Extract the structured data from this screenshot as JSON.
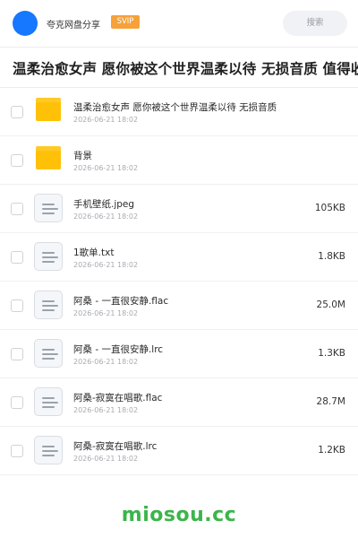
{
  "header": {
    "user_name": "夸克网盘分享",
    "badge": "SVIP",
    "search_placeholder": "搜索",
    "accent_color": "#1677ff"
  },
  "share": {
    "title": "温柔治愈女声 愿你被这个世界温柔以待 无损音质 值得收藏"
  },
  "files": [
    {
      "name": "温柔治愈女声  愿你被这个世界温柔以待 无损音质",
      "date": "2026-06-21 18:02",
      "size": "",
      "type": "folder",
      "icon": "folder-icon"
    },
    {
      "name": "背景",
      "date": "2026-06-21 18:02",
      "size": "",
      "type": "folder",
      "icon": "folder-icon"
    },
    {
      "name": "手机壁纸.jpeg",
      "date": "2026-06-21 18:02",
      "size": "105KB",
      "type": "file",
      "icon": "file-icon"
    },
    {
      "name": "1歌单.txt",
      "date": "2026-06-21 18:02",
      "size": "1.8KB",
      "type": "file",
      "icon": "file-icon"
    },
    {
      "name": "阿桑 - 一直很安静.flac",
      "date": "2026-06-21 18:02",
      "size": "25.0M",
      "type": "file",
      "icon": "file-icon"
    },
    {
      "name": "阿桑 - 一直很安静.lrc",
      "date": "2026-06-21 18:02",
      "size": "1.3KB",
      "type": "file",
      "icon": "file-icon"
    },
    {
      "name": "阿桑-寂寞在唱歌.flac",
      "date": "2026-06-21 18:02",
      "size": "28.7M",
      "type": "file",
      "icon": "file-icon"
    },
    {
      "name": "阿桑-寂寞在唱歌.lrc",
      "date": "2026-06-21 18:02",
      "size": "1.2KB",
      "type": "file",
      "icon": "file-icon"
    }
  ],
  "watermark": "miosou.cc"
}
